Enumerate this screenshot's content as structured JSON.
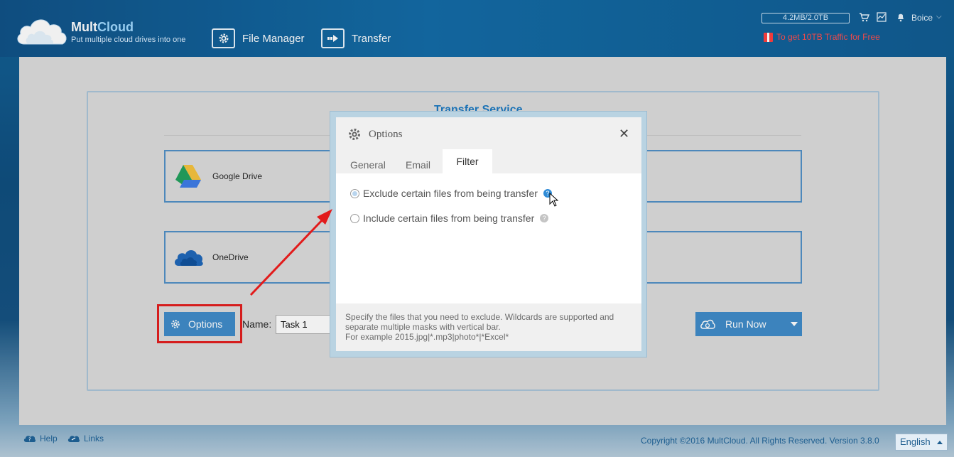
{
  "header": {
    "brand_prefix": "Mult",
    "brand_suffix": "Cloud",
    "tagline": "Put multiple cloud drives into one",
    "nav": {
      "file_manager": "File Manager",
      "transfer": "Transfer"
    },
    "traffic": "4.2MB/2.0TB",
    "user": "Boice",
    "promo": "To get 10TB Traffic for Free"
  },
  "main": {
    "title": "Transfer Service",
    "source_drive": "Google Drive",
    "target_drive": "OneDrive",
    "options_label": "Options",
    "name_label": "Name:",
    "task_name": "Task 1",
    "run_label": "Run Now"
  },
  "modal": {
    "title": "Options",
    "tabs": {
      "general": "General",
      "email": "Email",
      "filter": "Filter"
    },
    "exclude_label": "Exclude certain files from being transfer",
    "include_label": "Include certain files from being transfer",
    "help_glyph": "?",
    "footer_line1": "Specify the files that you need to exclude. Wildcards are supported and",
    "footer_line2": "separate multiple masks with vertical bar.",
    "footer_line3": "For example 2015.jpg|*.mp3|photo*|*Excel*"
  },
  "footer": {
    "help": "Help",
    "links": "Links",
    "copyright": "Copyright ©2016 MultCloud. All Rights Reserved. Version 3.8.0",
    "language": "English"
  },
  "colors": {
    "accent": "#3c89c8",
    "annotation_red": "#e21b1b",
    "promo_red": "#ff4a4a"
  }
}
